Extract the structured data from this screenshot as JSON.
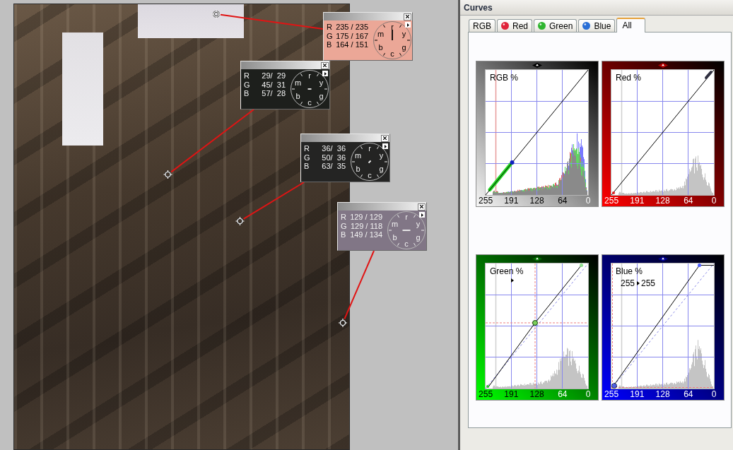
{
  "canvas": {
    "probes": [
      {
        "color": "#eba797",
        "rows": [
          {
            "channel": "R",
            "value": "235 / 235"
          },
          {
            "channel": "G",
            "value": "175 / 167"
          },
          {
            "channel": "B",
            "value": "164 / 151"
          }
        ],
        "dial_labels": [
          "r",
          "y",
          "g",
          "c",
          "b",
          "m"
        ]
      },
      {
        "color": "#1d1f1c",
        "rows": [
          {
            "channel": "R",
            "value": "29/  29"
          },
          {
            "channel": "G",
            "value": "45/  31"
          },
          {
            "channel": "B",
            "value": "57/  28"
          }
        ],
        "dial_labels": [
          "r",
          "y",
          "g",
          "c",
          "b",
          "m"
        ]
      },
      {
        "color": "#242423",
        "rows": [
          {
            "channel": "R",
            "value": "36/  36"
          },
          {
            "channel": "G",
            "value": "50/  36"
          },
          {
            "channel": "B",
            "value": "63/  35"
          }
        ],
        "dial_labels": [
          "r",
          "y",
          "g",
          "c",
          "b",
          "m"
        ]
      },
      {
        "color": "#817686",
        "rows": [
          {
            "channel": "R",
            "value": "129 / 129"
          },
          {
            "channel": "G",
            "value": "129 / 118"
          },
          {
            "channel": "B",
            "value": "149 / 134"
          }
        ],
        "dial_labels": [
          "r",
          "y",
          "g",
          "c",
          "b",
          "m"
        ]
      }
    ]
  },
  "panel": {
    "title": "Curves",
    "tabs": [
      {
        "label": "RGB",
        "selected": false
      },
      {
        "label": "Red",
        "color": "#e0243a",
        "selected": false
      },
      {
        "label": "Green",
        "color": "#2fb52f",
        "selected": false
      },
      {
        "label": "Blue",
        "color": "#2a6fd6",
        "selected": false
      },
      {
        "label": "All",
        "selected": true
      }
    ],
    "curves": [
      {
        "kind": "rgb",
        "title": "RGB %",
        "axis_labels": [
          "255",
          "191",
          "128",
          "64",
          "0"
        ]
      },
      {
        "kind": "red",
        "title": "Red %",
        "axis_labels": [
          "255",
          "191",
          "128",
          "64",
          "0"
        ]
      },
      {
        "kind": "green",
        "title": "Green %",
        "readout_arrow": true,
        "axis_labels": [
          "255",
          "191",
          "128",
          "64",
          "0"
        ]
      },
      {
        "kind": "blue",
        "title": "Blue %",
        "readout_arrow": true,
        "readout_from": "255",
        "readout_to": "255",
        "axis_labels": [
          "255",
          "191",
          "128",
          "64",
          "0"
        ]
      }
    ]
  }
}
